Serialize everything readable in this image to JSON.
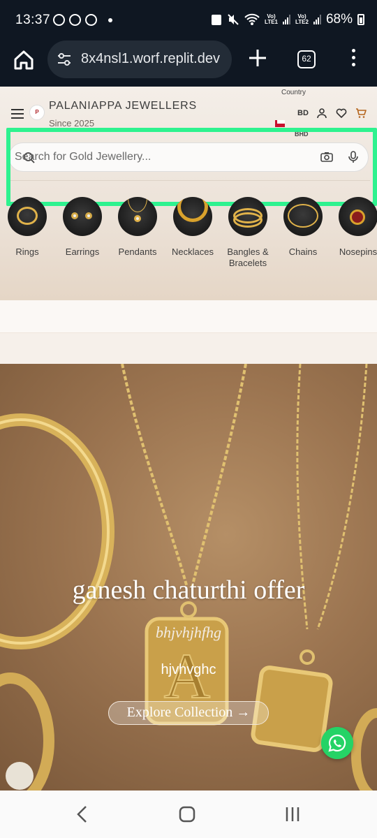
{
  "status_bar": {
    "time": "13:37",
    "net1": "Vo)\nLTE1",
    "net2": "Vo)\nLTE2",
    "battery": "68%"
  },
  "browser": {
    "url": "8x4nsl1.worf.replit.dev",
    "tab_count": "62"
  },
  "header": {
    "brand_name": "PALANIAPPA JEWELLERS",
    "tagline": "Since 2025",
    "country_label": "Country",
    "country_code": "BD",
    "currency": "BHD"
  },
  "search": {
    "placeholder": "Search for Gold Jewellery..."
  },
  "categories": [
    {
      "label": "Rings"
    },
    {
      "label": "Earrings"
    },
    {
      "label": "Pendants"
    },
    {
      "label": "Necklaces"
    },
    {
      "label": "Bangles & Bracelets"
    },
    {
      "label": "Chains"
    },
    {
      "label": "Nosepins"
    }
  ],
  "hero": {
    "title": "ganesh chaturthi offer",
    "subtitle": "bhjvhjhfhg",
    "description": "hjvhvghc",
    "cta": "Explore Collection →"
  },
  "colors": {
    "highlight": "#2ef28f",
    "whatsapp": "#25d366",
    "status_bg": "#0f1722",
    "cart": "#b5651d"
  }
}
